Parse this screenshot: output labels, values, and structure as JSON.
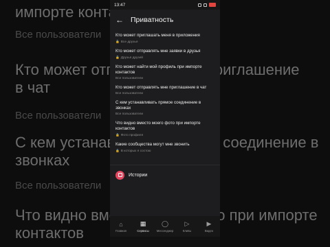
{
  "background": {
    "lines": [
      {
        "text": "импорте контактов",
        "kind": "big"
      },
      {
        "text": "Все пользователи",
        "kind": "small"
      },
      {
        "text": "Кто может отправлять мне приглашение",
        "kind": "big"
      },
      {
        "text": "в чат",
        "kind": "big"
      },
      {
        "text": "Все пользователи",
        "kind": "small"
      },
      {
        "text": "С кем устанавливать прямое соединение в",
        "kind": "big"
      },
      {
        "text": "звонках",
        "kind": "big"
      },
      {
        "text": "Все пользователи",
        "kind": "small"
      },
      {
        "text": "Что видно вместо моего фото при импорте",
        "kind": "big"
      },
      {
        "text": "контактов",
        "kind": "big"
      }
    ]
  },
  "status_bar": {
    "time": "13:47",
    "battery_color": "#e0463f"
  },
  "header": {
    "back_icon": "arrow-left-icon",
    "title": "Приватность"
  },
  "settings": [
    {
      "label": "Кто может приглашать меня в приложения",
      "value": "Все друзья",
      "locked": true
    },
    {
      "label": "Кто может отправлять мне заявки в друзья",
      "value": "Друзья друзей",
      "locked": true
    },
    {
      "label": "Кто может найти мой профиль при импорте контактов",
      "value": "Все пользователи",
      "locked": false
    },
    {
      "label": "Кто может отправлять мне приглашение в чат",
      "value": "Все пользователи",
      "locked": false
    },
    {
      "label": "С кем устанавливать прямое соединение в звонках",
      "value": "Все пользователи",
      "locked": false
    },
    {
      "label": "Что видно вместо моего фото при импорте контактов",
      "value": "Фото профиля",
      "locked": true
    },
    {
      "label": "Какие сообщества могут мне звонить",
      "value": "В которых я состою",
      "locked": true
    }
  ],
  "stories": {
    "label": "Истории",
    "icon_color": "#e3465f"
  },
  "bottom_nav": [
    {
      "label": "Главная",
      "icon": "home-icon",
      "active": false
    },
    {
      "label": "Сервисы",
      "icon": "services-grid-icon",
      "active": true
    },
    {
      "label": "Мессенджер",
      "icon": "chat-bubble-icon",
      "active": false
    },
    {
      "label": "Клипы",
      "icon": "clips-icon",
      "active": false
    },
    {
      "label": "Видео",
      "icon": "video-icon",
      "active": false
    }
  ]
}
